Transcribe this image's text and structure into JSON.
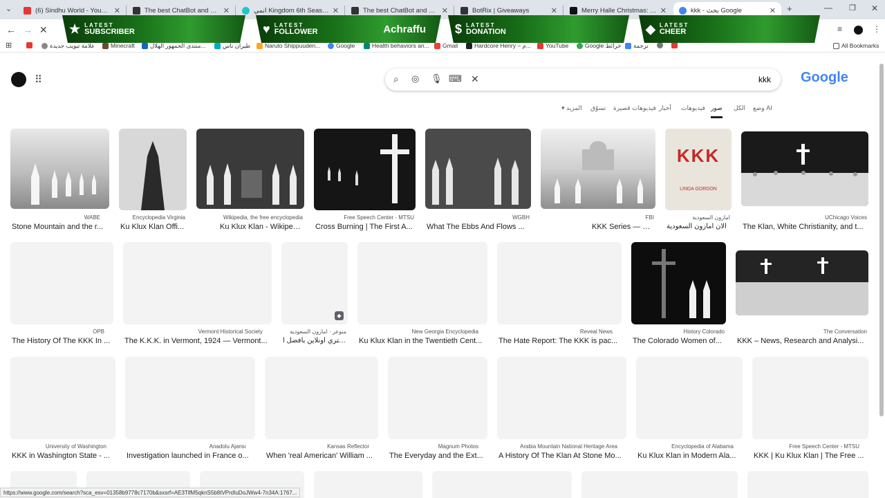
{
  "tabs": [
    {
      "title": "(6) Sindhu World - YouTube",
      "color": "#e53935"
    },
    {
      "title": "The best ChatBot and Widgets",
      "color": "#333"
    },
    {
      "title": "انمي Kingdom 6th Season الحلقة",
      "color": "#1ec8c8"
    },
    {
      "title": "The best ChatBot and Widgets",
      "color": "#333"
    },
    {
      "title": "BotRix | Giveaways",
      "color": "#333"
    },
    {
      "title": "Merry Halle Christmas: A Fun M",
      "color": "#111"
    },
    {
      "title": "kkk - بحث Google",
      "color": "#4285f4"
    }
  ],
  "overlays": [
    {
      "l1": "LATEST",
      "l2": "SUBSCRIBER",
      "icon": "★",
      "name": ""
    },
    {
      "l1": "LATEST",
      "l2": "FOLLOWER",
      "icon": "♥",
      "name": "Achraffu"
    },
    {
      "l1": "LATEST",
      "l2": "DONATION",
      "icon": "$",
      "name": ""
    },
    {
      "l1": "LATEST",
      "l2": "CHEER",
      "icon": "◆",
      "name": ""
    }
  ],
  "bookmarks": [
    "علامة تبويب جديدة",
    "Minecraft",
    "منتدى الجمهور الهلال...",
    "طيران ناس",
    "Naruto Shippuuden...",
    "Google",
    "Health behaviors an...",
    "Gmail",
    "Hardcore Henry – م...",
    "YouTube",
    "Google خرائط",
    "ترجمة",
    "All Bookmarks"
  ],
  "search": {
    "query": "kkk",
    "logo": "Google"
  },
  "filters": [
    "وضع AI",
    "الكل",
    "صور",
    "فيديوهات",
    "أخبار",
    "فيديوهات قصيرة",
    "تسوّق",
    "المزيد"
  ],
  "results": [
    {
      "src": "WABE",
      "title": "Stone Mountain and the r..."
    },
    {
      "src": "Encyclopedia Virginia",
      "title": "Ku Klux Klan Offi..."
    },
    {
      "src": "Wikipedia, the free encyclopedia",
      "title": "Ku Klux Klan - Wikipedia"
    },
    {
      "src": "Free Speech Center - MTSU",
      "title": "Cross Burning | The First A..."
    },
    {
      "src": "WGBH",
      "title": "What The Ebbs And Flows ..."
    },
    {
      "src": "FBI",
      "title": "KKK Series — FBI"
    },
    {
      "src": "امازون السعودية",
      "title": "الان امازون السعودية"
    },
    {
      "src": "UChicago Voices",
      "title": "The Klan, White Christianity, and t..."
    },
    {
      "src": "OPB",
      "title": "The History Of The KKK In ..."
    },
    {
      "src": "Vermont Historical Society",
      "title": "The K.K.K. in Vermont, 1924 — Vermont..."
    },
    {
      "src": "منوعر · امازون السعودية",
      "title": "اشتري اونلاين بأفضل ا..."
    },
    {
      "src": "New Georgia Encyclopedia",
      "title": "Ku Klux Klan in the Twentieth Cent..."
    },
    {
      "src": "Reveal News",
      "title": "The Hate Report: The KKK is pac..."
    },
    {
      "src": "History Colorado",
      "title": "The Colorado Women of..."
    },
    {
      "src": "The Conversation",
      "title": "KKK – News, Research and Analysi..."
    },
    {
      "src": "University of Washington",
      "title": "KKK in Washington State - ..."
    },
    {
      "src": "Anadolu Ajansı",
      "title": "Investigation launched in France o..."
    },
    {
      "src": "Kansas Reflector",
      "title": "When 'real American' William ..."
    },
    {
      "src": "Magnum Photos",
      "title": "The Everyday and the Ext..."
    },
    {
      "src": "Arabia Mountain National Heritage Area",
      "title": "A History Of The Klan At Stone Mo..."
    },
    {
      "src": "Encyclopedia of Alabama",
      "title": "Ku Klux Klan in Modern Ala..."
    },
    {
      "src": "Free Speech Center - MTSU",
      "title": "KKK | Ku Klux Klan | The Free ..."
    }
  ],
  "status_url": "https://www.google.com/search?sca_esv=01358b9778c7170b&sxsrf=AE3TifM5qknS5b8tVPrdIuDoJWw4-7n34A:1767..."
}
